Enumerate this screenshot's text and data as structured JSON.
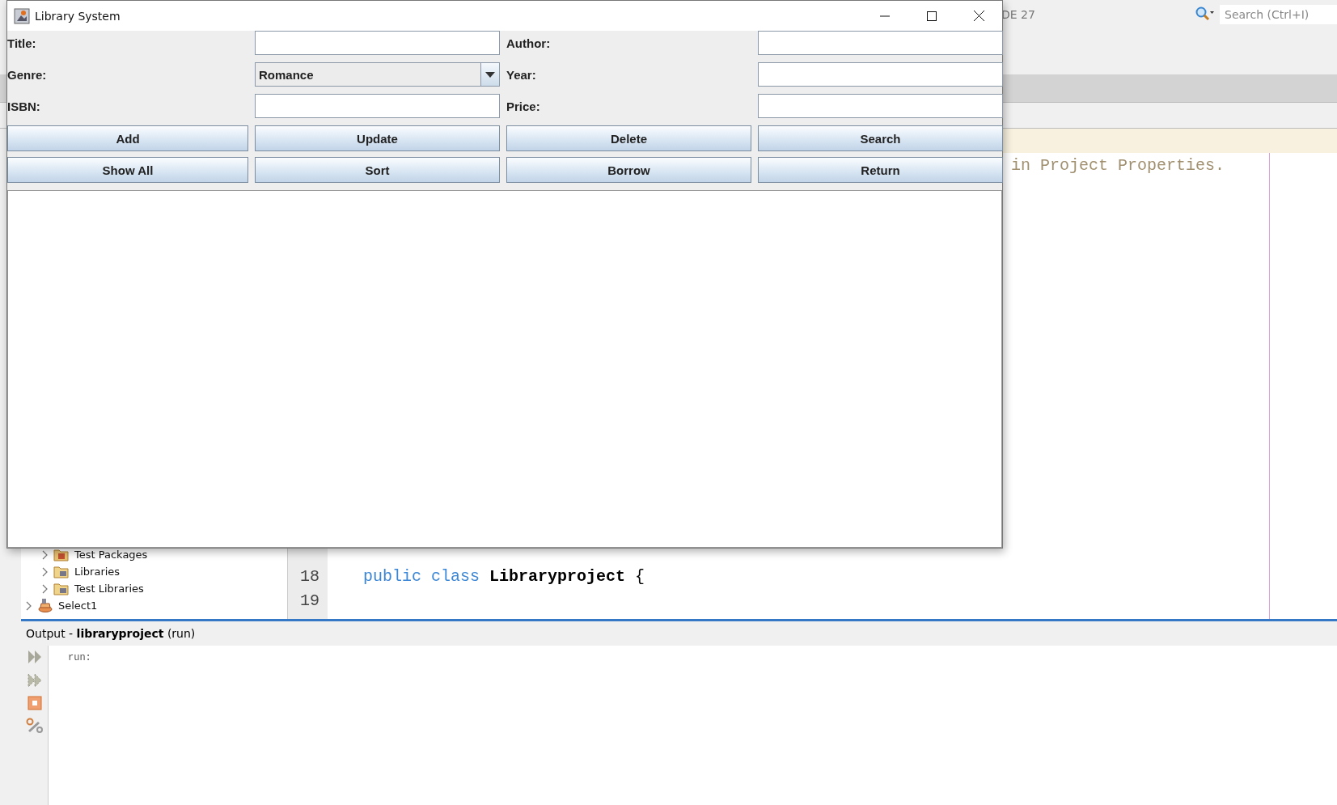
{
  "ide": {
    "toolbar": {
      "partial_label": "DE 27",
      "search": {
        "placeholder": "Search (Ctrl+I)"
      }
    },
    "project_tree": [
      {
        "label": "Test Packages",
        "kind": "package-folder",
        "expanded": false
      },
      {
        "label": "Libraries",
        "kind": "library-folder",
        "expanded": false
      },
      {
        "label": "Test Libraries",
        "kind": "library-folder",
        "expanded": false
      },
      {
        "label": "Select1",
        "kind": "project",
        "expanded": false
      }
    ],
    "editor": {
      "top_lines": [
        {
          "highlighted": true
        },
        {
          "text": "in Project Properties.",
          "highlighted": false
        }
      ],
      "bottom_lines": [
        {
          "number": "18",
          "tokens": [
            {
              "text": "public",
              "kind": "keyword"
            },
            {
              "text": "class",
              "kind": "keyword"
            },
            {
              "text": "Libraryproject",
              "kind": "name"
            },
            {
              "text": "{",
              "kind": "plain"
            }
          ]
        },
        {
          "number": "19"
        }
      ]
    },
    "output": {
      "title": "Output - **libraryproject** (run)",
      "lines": [
        "run:"
      ]
    }
  },
  "window": {
    "title": "Library System",
    "fields": [
      {
        "label": "Title:",
        "kind": "text"
      },
      {
        "label": "Author:",
        "kind": "text"
      },
      {
        "label": "Genre:",
        "kind": "combo",
        "value": "Romance"
      },
      {
        "label": "Year:",
        "kind": "text"
      },
      {
        "label": "ISBN:",
        "kind": "text"
      },
      {
        "label": "Price:",
        "kind": "text"
      }
    ],
    "buttons": [
      "Add",
      "Update",
      "Delete",
      "Search",
      "Show All",
      "Sort",
      "Borrow",
      "Return"
    ]
  }
}
